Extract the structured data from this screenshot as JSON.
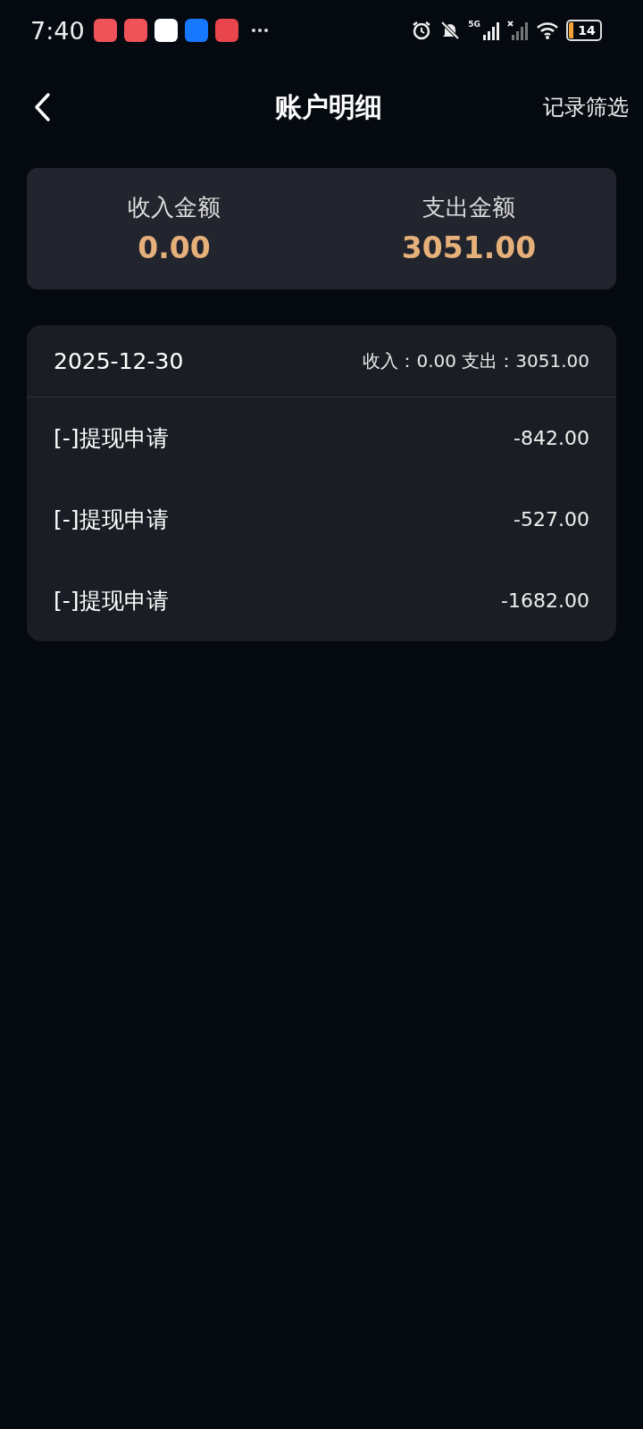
{
  "status_bar": {
    "time": "7:40",
    "notifications": [
      {
        "color": "#f0525a"
      },
      {
        "color": "#f0525a"
      },
      {
        "color": "#ffffff"
      },
      {
        "color": "#1677ff"
      },
      {
        "color": "#e8454c"
      }
    ],
    "network": "5G",
    "battery": "14"
  },
  "nav": {
    "title": "账户明细",
    "action": "记录筛选"
  },
  "summary": [
    {
      "label": "收入金额",
      "amount": "0.00"
    },
    {
      "label": "支出金额",
      "amount": "3051.00"
    }
  ],
  "days": [
    {
      "date": "2025-12-30",
      "totals": "收入：0.00 支出：3051.00",
      "records": [
        {
          "title": "[-]提现申请",
          "amount": "-842.00"
        },
        {
          "title": "[-]提现申请",
          "amount": "-527.00"
        },
        {
          "title": "[-]提现申请",
          "amount": "-1682.00"
        }
      ]
    }
  ]
}
